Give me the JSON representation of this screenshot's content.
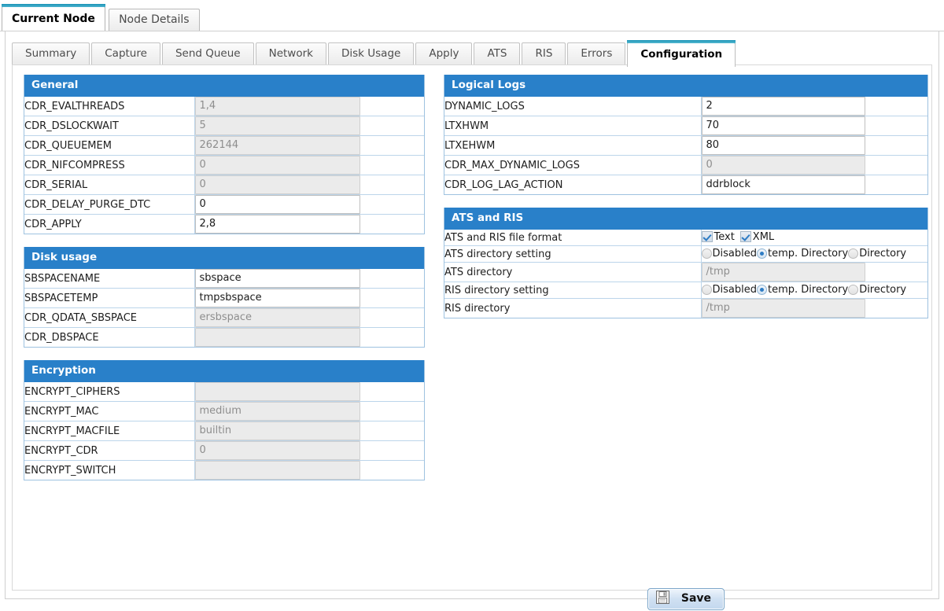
{
  "outer_tabs": [
    {
      "label": "Current Node",
      "active": true
    },
    {
      "label": "Node Details",
      "active": false
    }
  ],
  "inner_tabs": [
    {
      "label": "Summary",
      "active": false
    },
    {
      "label": "Capture",
      "active": false
    },
    {
      "label": "Send Queue",
      "active": false
    },
    {
      "label": "Network",
      "active": false
    },
    {
      "label": "Disk Usage",
      "active": false
    },
    {
      "label": "Apply",
      "active": false
    },
    {
      "label": "ATS",
      "active": false
    },
    {
      "label": "RIS",
      "active": false
    },
    {
      "label": "Errors",
      "active": false
    },
    {
      "label": "Configuration",
      "active": true
    }
  ],
  "colors": {
    "section_header": "#2980c9",
    "active_tab_bar": "#1a93b6",
    "section_border": "#9ec2e0",
    "disabled_field_bg": "#ebebeb",
    "disabled_field_text": "#8e8e8e"
  },
  "sections": {
    "general": {
      "title": "General",
      "rows": [
        {
          "label": "CDR_EVALTHREADS",
          "value": "1,4",
          "disabled": true
        },
        {
          "label": "CDR_DSLOCKWAIT",
          "value": "5",
          "disabled": true
        },
        {
          "label": "CDR_QUEUEMEM",
          "value": "262144",
          "disabled": true
        },
        {
          "label": "CDR_NIFCOMPRESS",
          "value": "0",
          "disabled": true
        },
        {
          "label": "CDR_SERIAL",
          "value": "0",
          "disabled": true
        },
        {
          "label": "CDR_DELAY_PURGE_DTC",
          "value": "0",
          "disabled": false
        },
        {
          "label": "CDR_APPLY",
          "value": "2,8",
          "disabled": false
        }
      ]
    },
    "disk_usage": {
      "title": "Disk usage",
      "rows": [
        {
          "label": "SBSPACENAME",
          "value": "sbspace",
          "disabled": false
        },
        {
          "label": "SBSPACETEMP",
          "value": "tmpsbspace",
          "disabled": false
        },
        {
          "label": "CDR_QDATA_SBSPACE",
          "value": "ersbspace",
          "disabled": true
        },
        {
          "label": "CDR_DBSPACE",
          "value": "",
          "disabled": true
        }
      ]
    },
    "encryption": {
      "title": "Encryption",
      "rows": [
        {
          "label": "ENCRYPT_CIPHERS",
          "value": "",
          "disabled": true
        },
        {
          "label": "ENCRYPT_MAC",
          "value": "medium",
          "disabled": true
        },
        {
          "label": "ENCRYPT_MACFILE",
          "value": "builtin",
          "disabled": true
        },
        {
          "label": "ENCRYPT_CDR",
          "value": "0",
          "disabled": true
        },
        {
          "label": "ENCRYPT_SWITCH",
          "value": "",
          "disabled": true
        }
      ]
    },
    "logical_logs": {
      "title": "Logical Logs",
      "rows": [
        {
          "label": "DYNAMIC_LOGS",
          "value": "2",
          "disabled": false
        },
        {
          "label": "LTXHWM",
          "value": "70",
          "disabled": false
        },
        {
          "label": "LTXEHWM",
          "value": "80",
          "disabled": false
        },
        {
          "label": "CDR_MAX_DYNAMIC_LOGS",
          "value": "0",
          "disabled": true
        },
        {
          "label": "CDR_LOG_LAG_ACTION",
          "value": "ddrblock",
          "disabled": false
        }
      ]
    },
    "ats_and_ris": {
      "title": "ATS and RIS",
      "file_format": {
        "label": "ATS and RIS file format",
        "options": [
          {
            "label": "Text",
            "checked": true
          },
          {
            "label": "XML",
            "checked": true
          }
        ]
      },
      "ats_dir_setting": {
        "label": "ATS directory setting",
        "options": [
          {
            "label": "Disabled",
            "selected": false
          },
          {
            "label": "temp. Directory",
            "selected": true
          },
          {
            "label": "Directory",
            "selected": false
          }
        ]
      },
      "ats_directory": {
        "label": "ATS directory",
        "value": "/tmp",
        "disabled": true
      },
      "ris_dir_setting": {
        "label": "RIS directory setting",
        "options": [
          {
            "label": "Disabled",
            "selected": false
          },
          {
            "label": "temp. Directory",
            "selected": true
          },
          {
            "label": "Directory",
            "selected": false
          }
        ]
      },
      "ris_directory": {
        "label": "RIS directory",
        "value": "/tmp",
        "disabled": true
      }
    }
  },
  "save_button": {
    "label": "Save",
    "icon": "floppy-disk-icon"
  }
}
